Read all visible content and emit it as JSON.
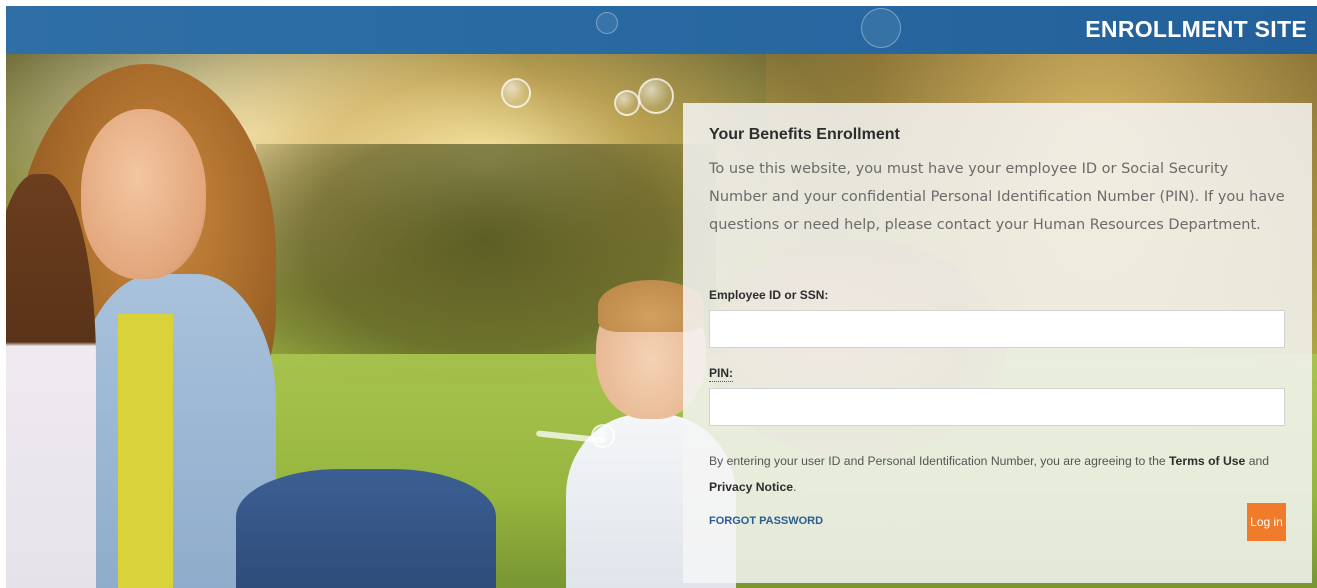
{
  "header": {
    "site_title": "ENROLLMENT SITE"
  },
  "login_panel": {
    "title": "Your Benefits Enrollment",
    "description": "To use this website, you must have your employee ID or Social Security Number and your confidential Personal Identification Number (PIN). If you have questions or need help, please contact your Human Resources Department.",
    "employee_id_label": "Employee ID or SSN:",
    "employee_id_value": "",
    "pin_label": "PIN:",
    "pin_value": "",
    "terms_prefix": "By entering your user ID and Personal Identification Number, you are agreeing to the ",
    "terms_link": "Terms of Use",
    "terms_and": " and ",
    "privacy_link": "Privacy Notice",
    "terms_suffix": ".",
    "forgot_password": "FORGOT PASSWORD",
    "login_button": "Log in"
  },
  "colors": {
    "header_blue": "#2a6aa3",
    "login_orange": "#f07b2a",
    "link_blue": "#2a5d92"
  }
}
